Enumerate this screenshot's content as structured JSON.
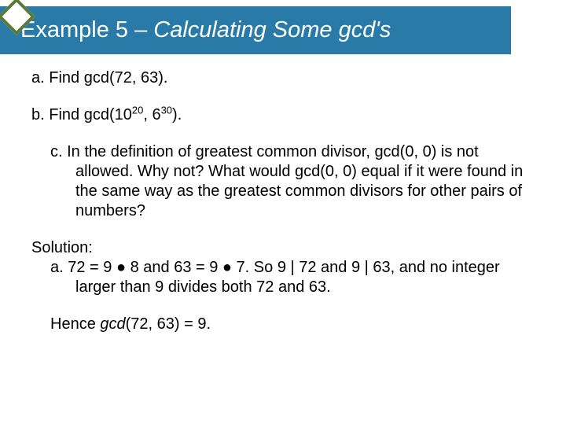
{
  "title": {
    "part1": "Example 5 – ",
    "part2": "Calculating Some gcd's"
  },
  "items": {
    "a": {
      "label": "a.",
      "text": " Find gcd(72, 63)."
    },
    "b": {
      "label": "b.",
      "prefix": " Find gcd(10",
      "sup1": "20",
      "mid": ", 6",
      "sup2": "30",
      "suffix": ")."
    },
    "c": {
      "label": "c.",
      "text": " In the definition of greatest common divisor, gcd(0, 0) is not allowed. Why not? What would gcd(0, 0) equal if it were found in the same way as the greatest common divisors for other pairs of numbers?"
    }
  },
  "solution": {
    "heading": "Solution:",
    "a_label": "a.",
    "a_text": " 72 = 9 ● 8 and 63 = 9 ● 7. So 9 | 72 and 9 | 63, and no integer larger than 9 divides both 72 and 63.",
    "hence_prefix": "Hence ",
    "hence_gcd": "gcd",
    "hence_suffix": "(72, 63) = 9."
  }
}
